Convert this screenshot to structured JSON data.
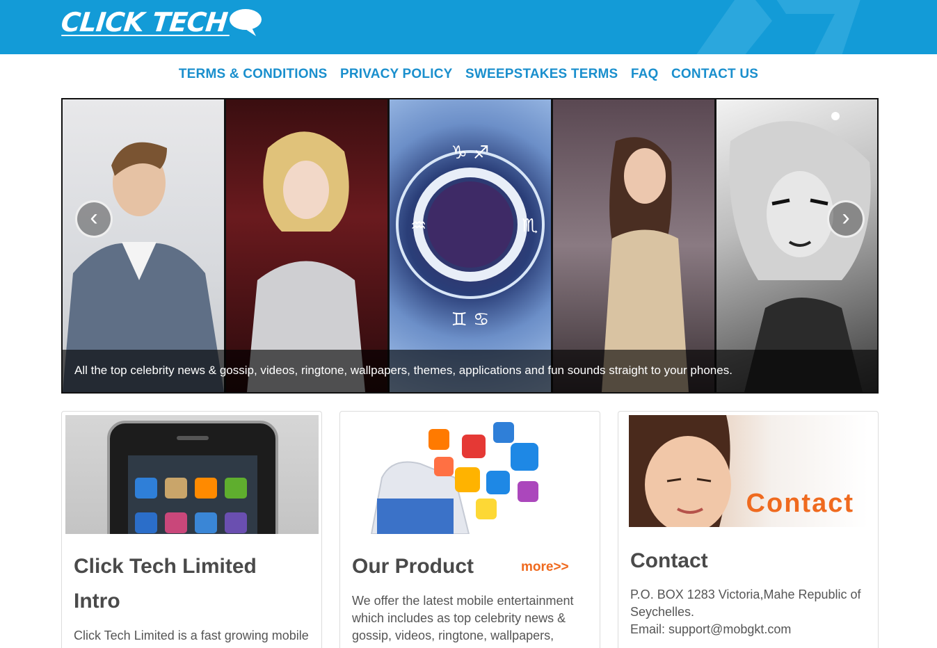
{
  "header": {
    "logo_text": "CLICK TECH",
    "brand_color": "#139bd7"
  },
  "nav": {
    "items": [
      {
        "label": "TERMS & CONDITIONS"
      },
      {
        "label": "PRIVACY POLICY"
      },
      {
        "label": "SWEEPSTAKES TERMS"
      },
      {
        "label": "FAQ"
      },
      {
        "label": "CONTACT US"
      }
    ]
  },
  "carousel": {
    "caption": "All the top celebrity news & gossip, videos, ringtone, wallpapers, themes, applications and fun sounds straight to your phones.",
    "prev_symbol": "‹",
    "next_symbol": "›",
    "dot_count": 1
  },
  "cards": [
    {
      "title": "Click Tech Limited Intro",
      "text": "Click Tech Limited is a fast growing mobile"
    },
    {
      "title": "Our Product",
      "more_label": "more>>",
      "text": "We offer the latest mobile entertainment which includes as top celebrity news & gossip, videos, ringtone, wallpapers,"
    },
    {
      "title": "Contact",
      "image_text": "Contact",
      "address": "P.O. BOX 1283 Victoria,Mahe Republic of Seychelles.",
      "email": "Email: support@mobgkt.com"
    }
  ],
  "colors": {
    "accent_link": "#1a8fcd",
    "orange": "#ef6a1f"
  }
}
